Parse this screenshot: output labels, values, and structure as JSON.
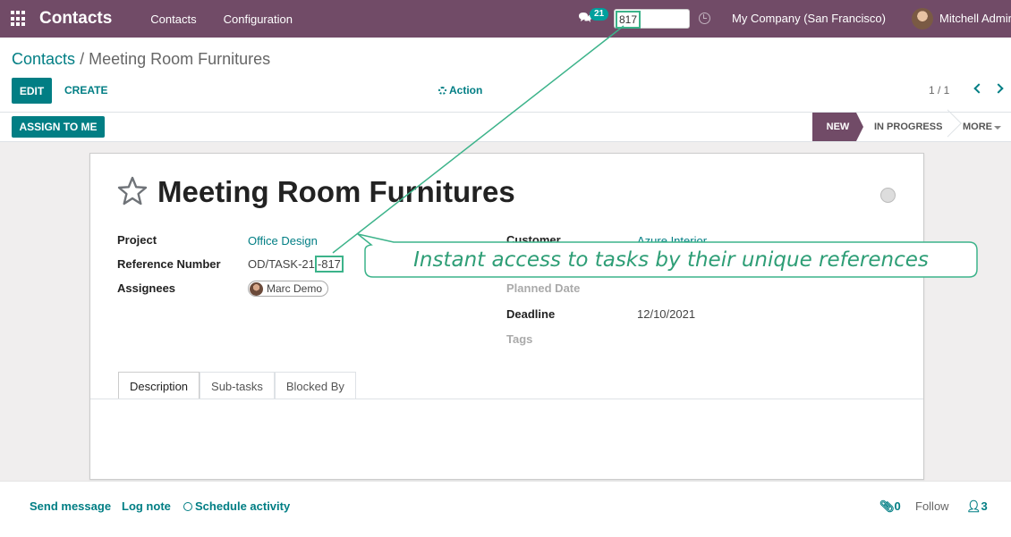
{
  "navbar": {
    "app_title": "Contacts",
    "menu": [
      "Contacts",
      "Configuration"
    ],
    "messages_count": "21",
    "search_value": "817",
    "company": "My Company (San Francisco)",
    "user": "Mitchell Admin",
    "color": "#714b67"
  },
  "breadcrumb": {
    "parent": "Contacts",
    "separator": "/",
    "current": "Meeting Room Furnitures"
  },
  "control_panel": {
    "edit_label": "EDIT",
    "create_label": "CREATE",
    "action_label": "Action",
    "pager": "1 / 1"
  },
  "statusbar": {
    "assign_label": "ASSIGN TO ME",
    "stages": [
      "NEW",
      "IN PROGRESS",
      "MORE"
    ],
    "active_stage": "NEW"
  },
  "task": {
    "title": "Meeting Room Furnitures",
    "fields_left": {
      "project_label": "Project",
      "project_value": "Office Design",
      "ref_label": "Reference Number",
      "ref_prefix": "OD/TASK-21",
      "ref_suffix": "-817",
      "assignees_label": "Assignees",
      "assignee": "Marc Demo"
    },
    "fields_right": {
      "customer_label": "Customer",
      "customer_value": "Azure Interior",
      "planned_label": "Planned Date",
      "deadline_label": "Deadline",
      "deadline_value": "12/10/2021",
      "tags_label": "Tags"
    }
  },
  "tabs": [
    "Description",
    "Sub-tasks",
    "Blocked By"
  ],
  "chatter": {
    "send_message": "Send message",
    "log_note": "Log note",
    "schedule_activity": "Schedule activity",
    "attachments": "0",
    "follow": "Follow",
    "followers": "3"
  },
  "callout": {
    "text": "Instant access to tasks by their unique references",
    "color": "#3cb38a"
  },
  "accent_color": "#017e84"
}
